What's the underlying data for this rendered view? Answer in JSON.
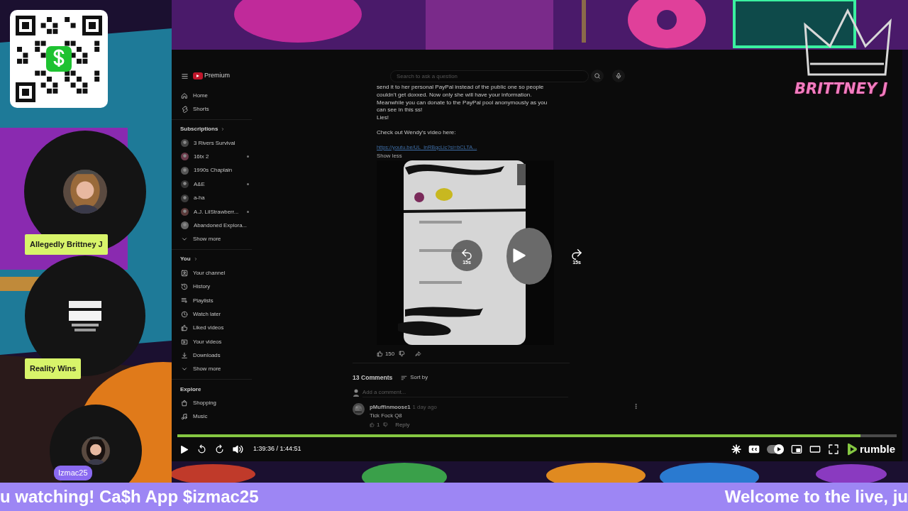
{
  "brand": {
    "name": "BRITTNEY J"
  },
  "participants": [
    {
      "name": "Allegedly Brittney J",
      "kind": "tag"
    },
    {
      "name": "Reality Wins",
      "kind": "tag"
    },
    {
      "name": "Izmac25",
      "kind": "pill"
    }
  ],
  "ticker": [
    "u watching! Ca$h App $izmac25",
    "Welcome to the live, ju"
  ],
  "page": {
    "logo": "Premium",
    "search": {
      "placeholder": "Search to ask a question"
    },
    "sidebar": [
      {
        "items": [
          {
            "label": "Home",
            "kind": "page"
          },
          {
            "label": "Shorts",
            "kind": "page"
          }
        ]
      },
      {
        "title": "Subscriptions",
        "items": [
          {
            "label": "3 Rivers Survival",
            "kind": "channel",
            "new": false
          },
          {
            "label": "16tx 2",
            "kind": "channel",
            "new": true
          },
          {
            "label": "1990s Chaplain",
            "kind": "channel",
            "new": false
          },
          {
            "label": "A&E",
            "kind": "channel",
            "new": true
          },
          {
            "label": "a-ha",
            "kind": "channel",
            "new": false
          },
          {
            "label": "A.J. LilStrawberr...",
            "kind": "channel",
            "new": true
          },
          {
            "label": "Abandoned Explora...",
            "kind": "channel",
            "new": false
          },
          {
            "label": "Show more",
            "kind": "more"
          }
        ]
      },
      {
        "title": "You",
        "items": [
          {
            "label": "Your channel",
            "kind": "page"
          },
          {
            "label": "History",
            "kind": "page"
          },
          {
            "label": "Playlists",
            "kind": "page"
          },
          {
            "label": "Watch later",
            "kind": "page"
          },
          {
            "label": "Liked videos",
            "kind": "page"
          },
          {
            "label": "Your videos",
            "kind": "page"
          },
          {
            "label": "Downloads",
            "kind": "page"
          },
          {
            "label": "Show more",
            "kind": "more"
          }
        ]
      },
      {
        "title": "Explore",
        "items": [
          {
            "label": "Shopping",
            "kind": "page"
          },
          {
            "label": "Music",
            "kind": "page"
          }
        ]
      }
    ],
    "description": [
      "send it to her personal PayPal instead of the public one so people couldn't get doxxed. Now only she will have your information. Meanwhile you can donate to the PayPal pool anonymously as you can see in this ss!",
      "Lies!",
      "Check out Wendy's video here:"
    ],
    "link": "https://youtu.be/UL_lnRBqcLic?si=bCLTA...",
    "show_less": "Show less",
    "video_overlay": {
      "rewind": "15s",
      "forward": "15s"
    },
    "likes": "150",
    "comments_title": "13 Comments",
    "sort": "Sort by",
    "add_comment": {
      "placeholder": "Add a comment..."
    },
    "comments": [
      {
        "author": "pMuffinmoose1",
        "time": "1 day ago",
        "text": "Tick Fock Q8",
        "likes": "1",
        "reply": "Reply"
      }
    ]
  },
  "player": {
    "progress": {
      "level": 0.95
    },
    "time": "1:39:36 / 1:44:51",
    "autoplay": true,
    "brand": "rumble"
  }
}
